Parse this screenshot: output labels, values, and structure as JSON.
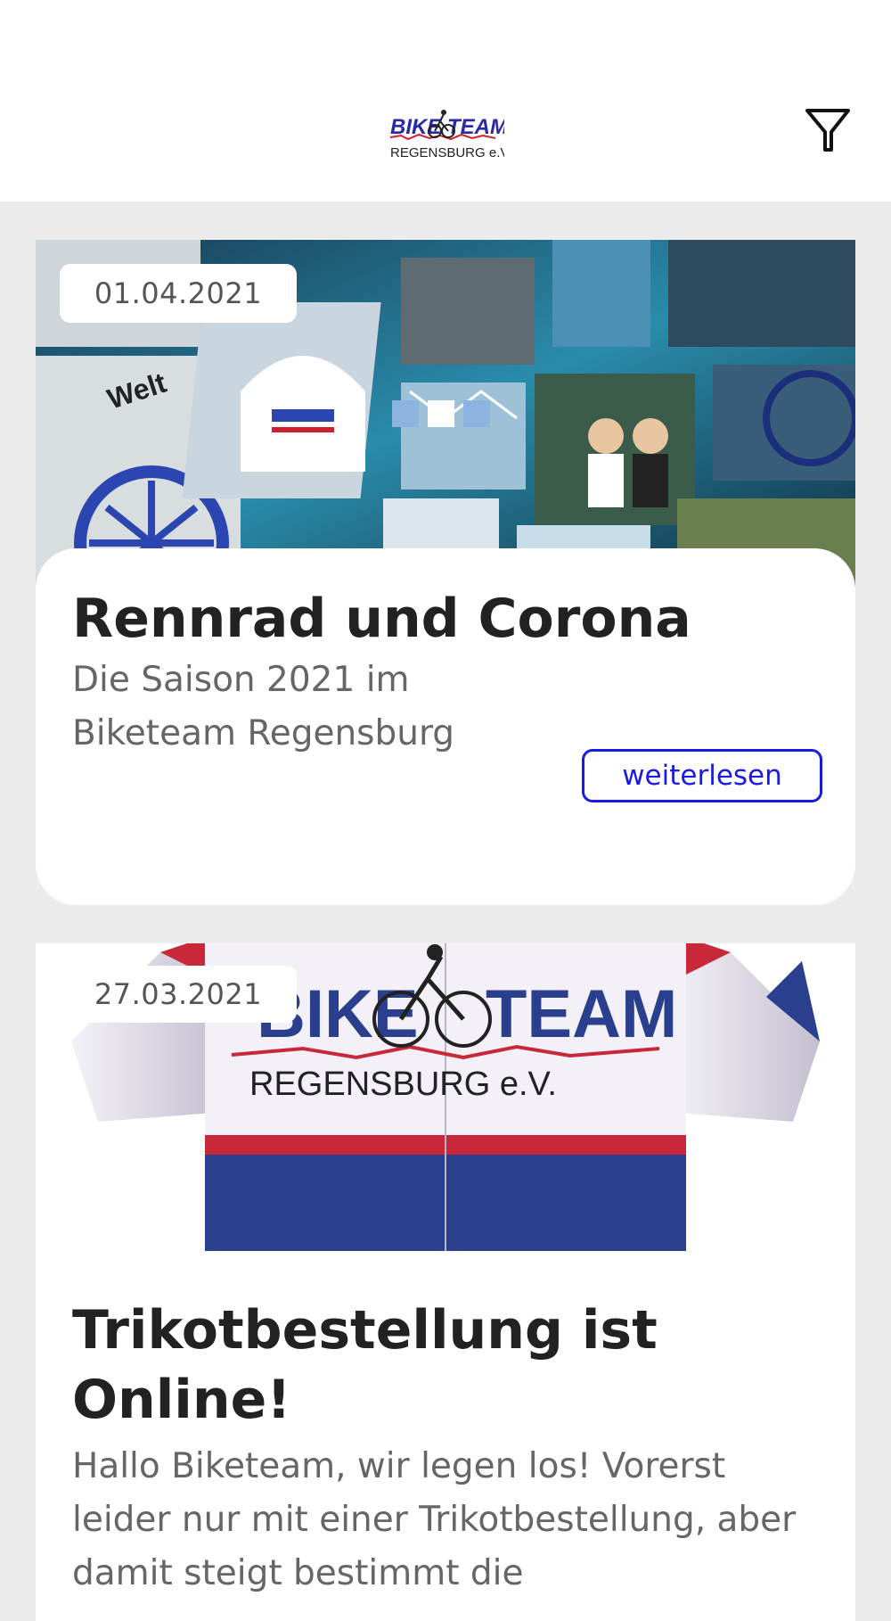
{
  "header": {
    "logo_line1_left": "BIKE",
    "logo_line1_right": "TEAM",
    "logo_line2": "REGENSBURG e.V.",
    "filter_icon": "filter-icon"
  },
  "posts": [
    {
      "date": "01.04.2021",
      "title": "Rennrad und Corona",
      "excerpt": "Die Saison 2021 im Biketeam Regensburg",
      "read_more": "weiterlesen",
      "image": "collage-image"
    },
    {
      "date": "27.03.2021",
      "title": "Trikotbestellung ist Online!",
      "excerpt": "Hallo Biketeam, wir legen los! Vorerst leider nur mit einer Trikotbestellung, aber damit steigt bestimmt die",
      "image": "jersey-image",
      "jersey_text_left": "BIKE",
      "jersey_text_right": "TEAM",
      "jersey_text_line2": "REGENSBURG e.V."
    }
  ],
  "colors": {
    "accent": "#1a1ae6",
    "background": "#ececec",
    "card": "#ffffff",
    "jersey_red": "#c8283a",
    "jersey_blue": "#2b3f8f"
  }
}
